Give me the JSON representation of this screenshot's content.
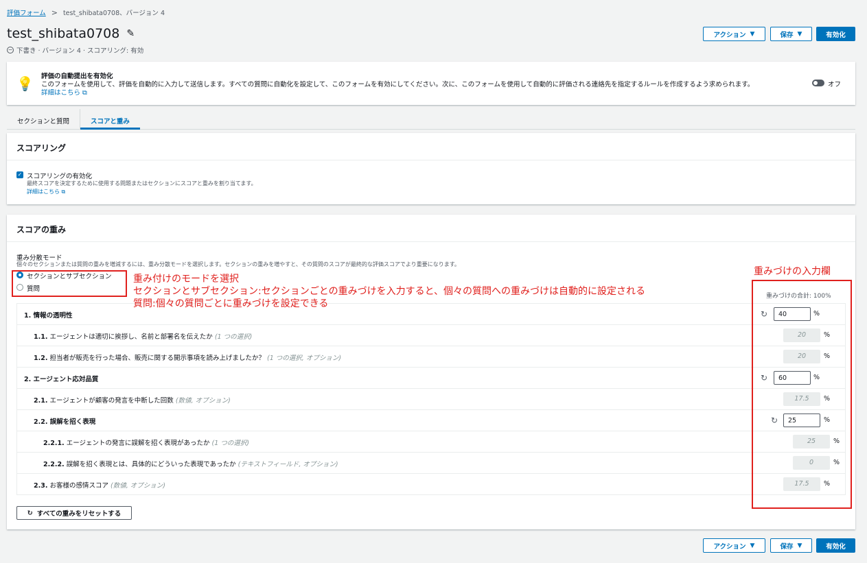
{
  "breadcrumb": {
    "root": "評価フォーム",
    "separator": ">",
    "current": "test_shibata0708、バージョン 4"
  },
  "page": {
    "title": "test_shibata0708",
    "subtitle": "下書き · バージョン 4 · スコアリング: 有効"
  },
  "header_buttons": {
    "action": "アクション",
    "save": "保存",
    "enable": "有効化"
  },
  "auto_submit": {
    "title": "評価の自動提出を有効化",
    "description": "このフォームを使用して、評価を自動的に入力して送信します。すべての質問に自動化を設定して、このフォームを有効にしてください。次に、このフォームを使用して自動的に評価される連絡先を指定するルールを作成するよう求められます。",
    "learn_more": "詳細はこちら",
    "toggle_label": "オフ",
    "toggle_on": false
  },
  "tabs": [
    {
      "label": "セクションと質問",
      "active": false
    },
    {
      "label": "スコアと重み",
      "active": true
    }
  ],
  "scoring": {
    "header": "スコアリング",
    "checkbox_label": "スコアリングの有効化",
    "checkbox_checked": true,
    "description": "最終スコアを決定するために使用する問題またはセクションにスコアと重みを割り当てます。",
    "learn_more": "詳細はこちら"
  },
  "weights": {
    "header": "スコアの重み",
    "mode_label": "重み分散モード",
    "mode_desc": "個々のセクションまたは質問の重みを増減するには、重み分散モードを選択します。セクションの重みを増やすと、その質問のスコアが最終的な評価スコアでより重要になります。",
    "modes": [
      {
        "label": "セクションとサブセクション",
        "checked": true
      },
      {
        "label": "質問",
        "checked": false
      }
    ],
    "total_label": "重みづけの合計: 100%",
    "rows": [
      {
        "num": "1.",
        "text": "情報の透明性",
        "meta": "",
        "value": "40",
        "editable": true
      },
      {
        "num": "1.1.",
        "text": "エージェントは適切に挨拶し、名前と部署名を伝えたか",
        "meta": "(1 つの選択)",
        "value": "20",
        "editable": false
      },
      {
        "num": "1.2.",
        "text": "担当者が販売を行った場合、販売に関する開示事項を読み上げましたか？",
        "meta": "(1 つの選択, オプション)",
        "value": "20",
        "editable": false
      },
      {
        "num": "2.",
        "text": "エージェント応対品質",
        "meta": "",
        "value": "60",
        "editable": true
      },
      {
        "num": "2.1.",
        "text": "エージェントが顧客の発言を中断した回数",
        "meta": "(数値, オプション)",
        "value": "17.5",
        "editable": false
      },
      {
        "num": "2.2.",
        "text": "誤解を招く表現",
        "meta": "",
        "value": "25",
        "editable": true
      },
      {
        "num": "2.2.1.",
        "text": "エージェントの発言に誤解を招く表現があったか",
        "meta": "(1 つの選択)",
        "value": "25",
        "editable": false
      },
      {
        "num": "2.2.2.",
        "text": "誤解を招く表現とは、具体的にどういった表現であったか",
        "meta": "(テキストフィールド, オプション)",
        "value": "0",
        "editable": false
      },
      {
        "num": "2.3.",
        "text": "お客様の感情スコア",
        "meta": "(数値, オプション)",
        "value": "17.5",
        "editable": false
      }
    ],
    "percent": "%",
    "reset_all": "すべての重みをリセットする"
  },
  "annotations": {
    "mode_title": "重み付けのモードを選択",
    "mode_line1": "セクションとサブセクション:セクションごとの重みづけを入力すると、個々の質問への重みづけは自動的に設定される",
    "mode_line2": "質問:個々の質問ごとに重みづけを設定できる",
    "input_title": "重みづけの入力欄",
    "color": "#e0201d"
  },
  "footer_buttons": {
    "action": "アクション",
    "save": "保存",
    "enable": "有効化"
  }
}
